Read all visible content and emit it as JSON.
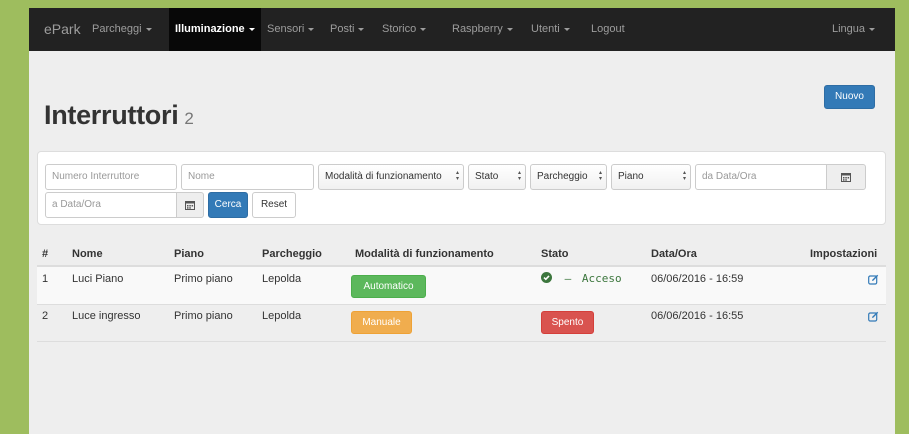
{
  "navbar": {
    "brand": "ePark",
    "items": [
      {
        "label": "Parcheggi",
        "dropdown": true
      },
      {
        "label": "Illuminazione",
        "dropdown": true,
        "active": true
      },
      {
        "label": "Sensori",
        "dropdown": true
      },
      {
        "label": "Posti",
        "dropdown": true
      },
      {
        "label": "Storico",
        "dropdown": true
      },
      {
        "label": "Raspberry",
        "dropdown": true
      },
      {
        "label": "Utenti",
        "dropdown": true
      },
      {
        "label": "Logout",
        "dropdown": false
      }
    ],
    "right_item": {
      "label": "Lingua",
      "dropdown": true
    }
  },
  "page": {
    "title": "Interruttori",
    "count": "2",
    "new_button": "Nuovo"
  },
  "filters": {
    "numero_placeholder": "Numero Interruttore",
    "nome_placeholder": "Nome",
    "modalita_select": "Modalità di funzionamento",
    "stato_select": "Stato",
    "parcheggio_select": "Parcheggio",
    "piano_select": "Piano",
    "da_data_placeholder": "da Data/Ora",
    "a_data_placeholder": "a Data/Ora",
    "search_button": "Cerca",
    "reset_button": "Reset"
  },
  "table": {
    "headers": [
      "#",
      "Nome",
      "Piano",
      "Parcheggio",
      "Modalità di funzionamento",
      "Stato",
      "Data/Ora",
      "Impostazioni"
    ],
    "rows": [
      {
        "id": "1",
        "nome": "Luci Piano",
        "piano": "Primo piano",
        "parcheggio": "Lepolda",
        "modalita": "Automatico",
        "stato": "Acceso",
        "stato_prefix": "–",
        "data": "06/06/2016 - 16:59"
      },
      {
        "id": "2",
        "nome": "Luce ingresso",
        "piano": "Primo piano",
        "parcheggio": "Lepolda",
        "modalita": "Manuale",
        "stato": "Spento",
        "data": "06/06/2016 - 16:55"
      }
    ]
  },
  "colors": {
    "navbar_bg": "#222222",
    "primary": "#337ab7",
    "success": "#5cb85c",
    "warning": "#f0ad4e",
    "danger": "#d9534f",
    "acceso_text": "#3c763d",
    "outer_border": "#9ebd5e"
  },
  "icons": {
    "calendar": "calendar-icon",
    "edit": "edit-icon",
    "ok": "check-circle-icon"
  }
}
